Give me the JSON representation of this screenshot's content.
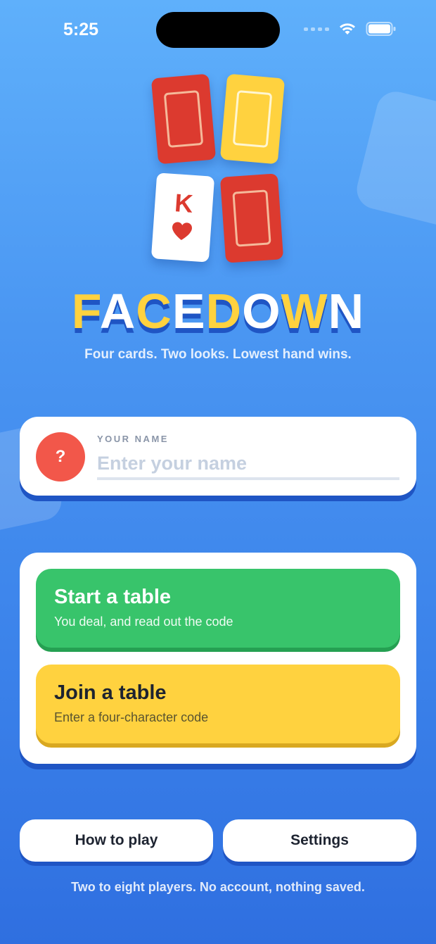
{
  "status_bar": {
    "time": "5:25"
  },
  "logo_card": {
    "letter": "K"
  },
  "title_letters": [
    {
      "char": "F",
      "color": "yellow"
    },
    {
      "char": "A",
      "color": "white"
    },
    {
      "char": "C",
      "color": "yellow"
    },
    {
      "char": "E",
      "color": "white"
    },
    {
      "char": "D",
      "color": "yellow"
    },
    {
      "char": "O",
      "color": "white"
    },
    {
      "char": "W",
      "color": "yellow"
    },
    {
      "char": "N",
      "color": "white"
    }
  ],
  "tagline": "Four cards. Two looks. Lowest hand wins.",
  "name_panel": {
    "avatar_text": "?",
    "label": "YOUR NAME",
    "value": "",
    "placeholder": "Enter your name"
  },
  "actions": {
    "start": {
      "title": "Start a table",
      "subtitle": "You deal, and read out the code"
    },
    "join": {
      "title": "Join a table",
      "subtitle": "Enter a four-character code"
    }
  },
  "bottom_buttons": {
    "how_to_play": "How to play",
    "settings": "Settings"
  },
  "footer": "Two to eight players. No account, nothing saved.",
  "colors": {
    "accent_yellow": "#ffd23f",
    "card_red": "#dc3a2f",
    "start_green": "#38c46b",
    "avatar_red": "#f2574a",
    "shadow_blue": "#1f55c4"
  }
}
